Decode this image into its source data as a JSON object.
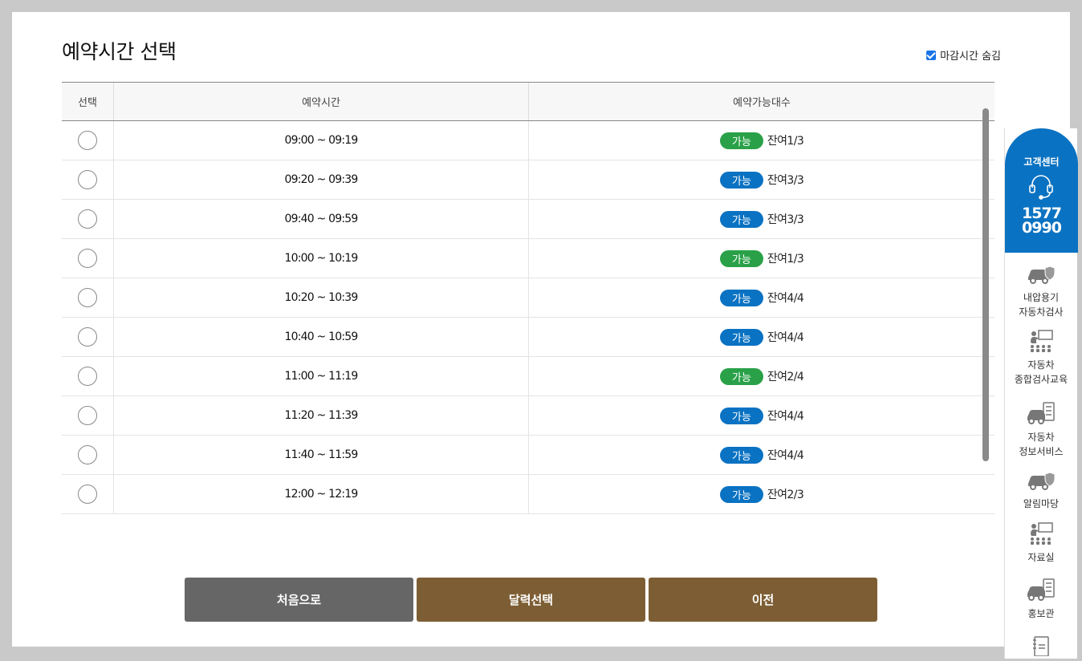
{
  "page_title": "예약시간 선택",
  "hide_closed_label": "마감시간 숨김",
  "hide_closed_checked": true,
  "columns": [
    "선택",
    "예약시간",
    "예약가능대수"
  ],
  "rows": [
    {
      "time": "09:00 ~ 09:19",
      "status": "가능",
      "status_color": "#2aa148",
      "remaining": "잔여1/3"
    },
    {
      "time": "09:20 ~ 09:39",
      "status": "가능",
      "status_color": "#0a72c2",
      "remaining": "잔여3/3"
    },
    {
      "time": "09:40 ~ 09:59",
      "status": "가능",
      "status_color": "#0a72c2",
      "remaining": "잔여3/3"
    },
    {
      "time": "10:00 ~ 10:19",
      "status": "가능",
      "status_color": "#2aa148",
      "remaining": "잔여1/3"
    },
    {
      "time": "10:20 ~ 10:39",
      "status": "가능",
      "status_color": "#0a72c2",
      "remaining": "잔여4/4"
    },
    {
      "time": "10:40 ~ 10:59",
      "status": "가능",
      "status_color": "#0a72c2",
      "remaining": "잔여4/4"
    },
    {
      "time": "11:00 ~ 11:19",
      "status": "가능",
      "status_color": "#2aa148",
      "remaining": "잔여2/4"
    },
    {
      "time": "11:20 ~ 11:39",
      "status": "가능",
      "status_color": "#0a72c2",
      "remaining": "잔여4/4"
    },
    {
      "time": "11:40 ~ 11:59",
      "status": "가능",
      "status_color": "#0a72c2",
      "remaining": "잔여4/4"
    },
    {
      "time": "12:00 ~ 12:19",
      "status": "가능",
      "status_color": "#0a72c2",
      "remaining": "잔여2/3"
    }
  ],
  "buttons": {
    "first": "처음으로",
    "calendar": "달력선택",
    "prev": "이전"
  },
  "sidebar": {
    "customer_center": {
      "title": "고객센터",
      "phone_line1": "1577",
      "phone_line2": "0990"
    },
    "items": [
      {
        "line1": "내압용기",
        "line2": "자동차검사",
        "icon": "car-shield-icon"
      },
      {
        "line1": "자동차",
        "line2": "종합검사교육",
        "icon": "classroom-icon"
      },
      {
        "line1": "자동차",
        "line2": "정보서비스",
        "icon": "car-checklist-icon"
      },
      {
        "line1": "알림마당",
        "line2": "",
        "icon": "car-shield-icon"
      },
      {
        "line1": "자료실",
        "line2": "",
        "icon": "classroom-icon"
      },
      {
        "line1": "홍보관",
        "line2": "",
        "icon": "car-checklist-icon"
      }
    ]
  },
  "colors": {
    "available_green": "#2aa148",
    "available_blue": "#0a72c2",
    "brand_blue": "#0a72c2",
    "button_brown": "#7d5e34",
    "button_gray": "#666666"
  }
}
